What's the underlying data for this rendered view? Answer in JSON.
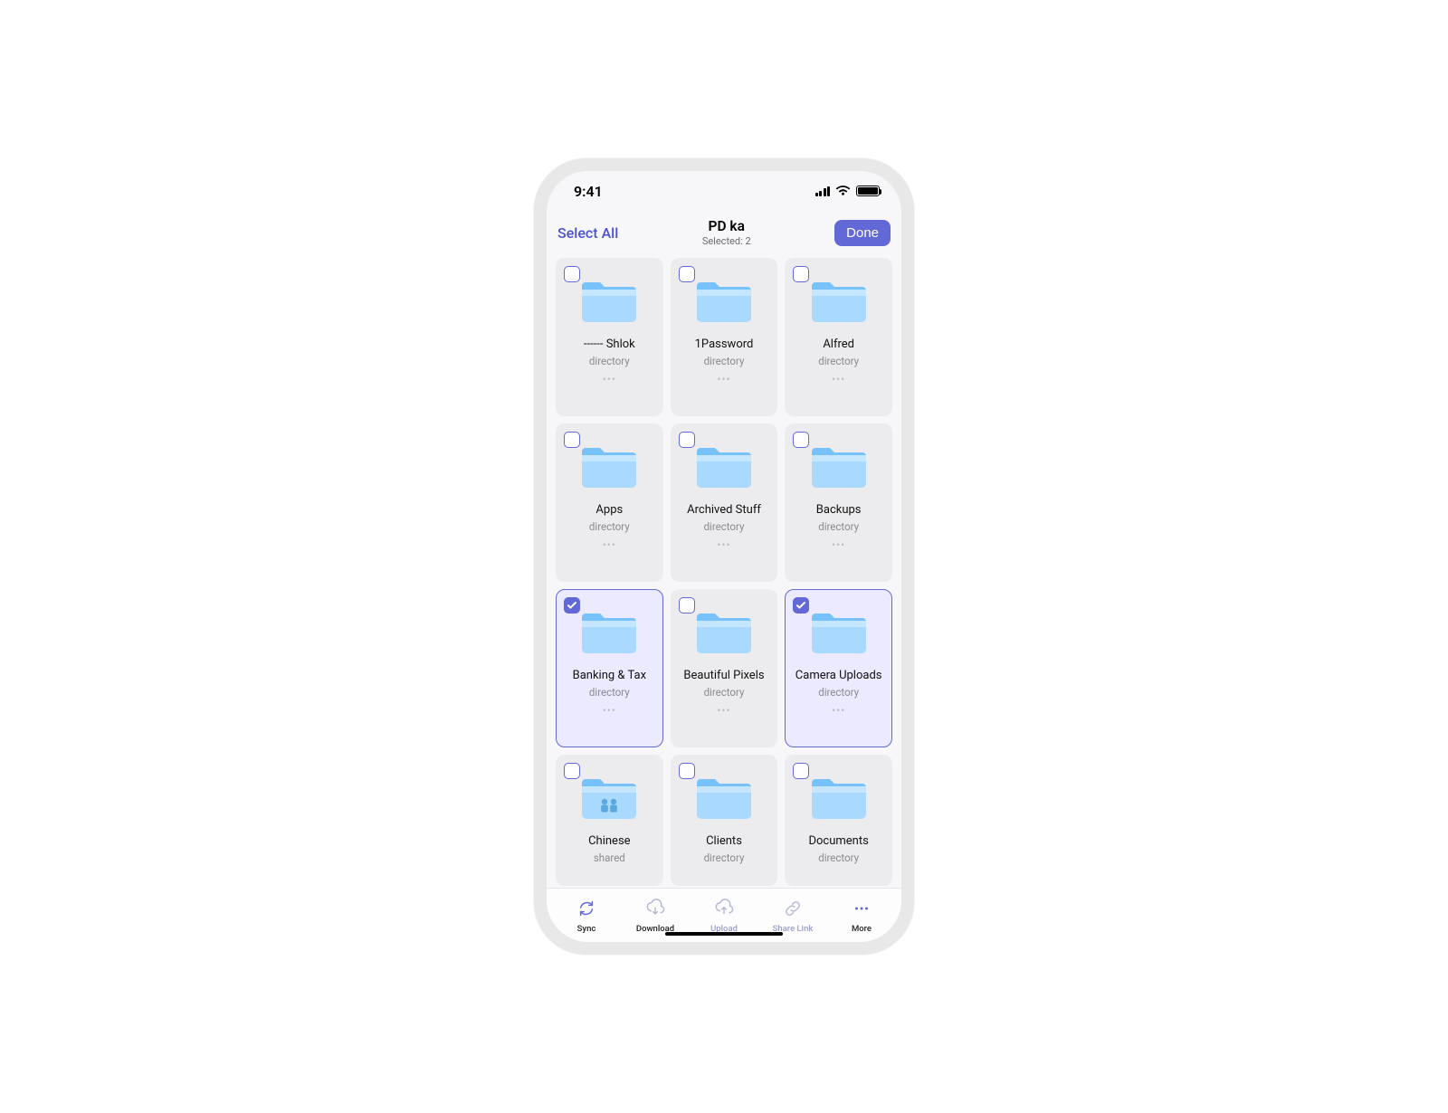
{
  "status": {
    "time": "9:41"
  },
  "header": {
    "select_all": "Select All",
    "title": "PD ka",
    "subtitle": "Selected: 2",
    "done": "Done"
  },
  "folders": [
    {
      "name": "------ Shlok",
      "kind": "directory",
      "selected": false,
      "shared": false
    },
    {
      "name": "1Password",
      "kind": "directory",
      "selected": false,
      "shared": false
    },
    {
      "name": "Alfred",
      "kind": "directory",
      "selected": false,
      "shared": false
    },
    {
      "name": "Apps",
      "kind": "directory",
      "selected": false,
      "shared": false
    },
    {
      "name": "Archived Stuff",
      "kind": "directory",
      "selected": false,
      "shared": false
    },
    {
      "name": "Backups",
      "kind": "directory",
      "selected": false,
      "shared": false
    },
    {
      "name": "Banking & Tax",
      "kind": "directory",
      "selected": true,
      "shared": false
    },
    {
      "name": "Beautiful Pixels",
      "kind": "directory",
      "selected": false,
      "shared": false
    },
    {
      "name": "Camera Uploads",
      "kind": "directory",
      "selected": true,
      "shared": false
    },
    {
      "name": "Chinese",
      "kind": "shared",
      "selected": false,
      "shared": true
    },
    {
      "name": "Clients",
      "kind": "directory",
      "selected": false,
      "shared": false
    },
    {
      "name": "Documents",
      "kind": "directory",
      "selected": false,
      "shared": false
    }
  ],
  "tabs": [
    {
      "label": "Sync",
      "icon": "sync"
    },
    {
      "label": "Download",
      "icon": "download"
    },
    {
      "label": "Upload",
      "icon": "upload"
    },
    {
      "label": "Share Link",
      "icon": "share-link"
    },
    {
      "label": "More",
      "icon": "more"
    }
  ],
  "colors": {
    "accent": "#6268d5",
    "folder_light": "#a9d9ff",
    "folder_dark": "#78c2fb"
  }
}
